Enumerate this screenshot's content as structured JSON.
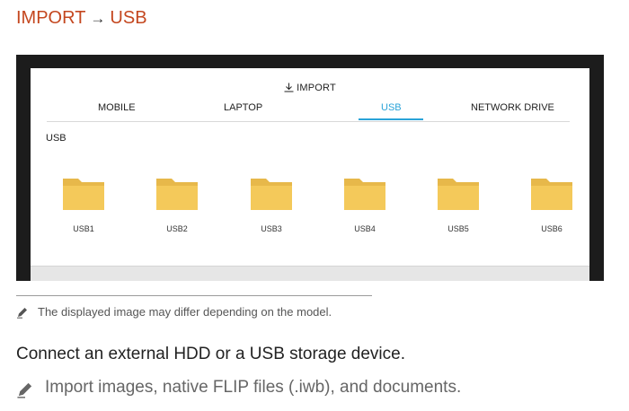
{
  "heading": {
    "part1": "IMPORT",
    "arrow": "→",
    "part2": "USB"
  },
  "screen": {
    "import_label": "IMPORT",
    "tabs": [
      "MOBILE",
      "LAPTOP",
      "USB",
      "NETWORK DRIVE"
    ],
    "active_tab": "USB",
    "section_title": "USB",
    "folders": [
      "USB1",
      "USB2",
      "USB3",
      "USB4",
      "USB5",
      "USB6"
    ],
    "folder_icon": "folder-icon"
  },
  "note_model": "The displayed image may differ depending on the model.",
  "instruction": "Connect an external HDD or a USB storage device.",
  "note_import": "Import images, native FLIP files (.iwb), and documents.",
  "colors": {
    "heading_accent": "#c4471f",
    "active_tab": "#2aa3d8",
    "folder": "#f4c95a"
  }
}
